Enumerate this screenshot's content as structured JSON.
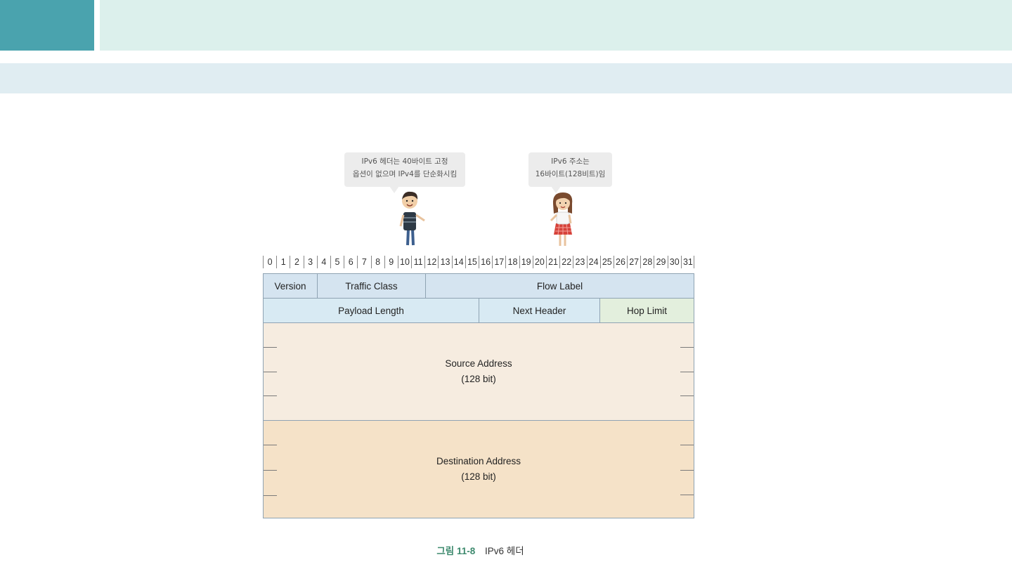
{
  "colors": {
    "header_square": "#4aa3ae",
    "header_bar": "#dcf0ec",
    "sub_bar": "#e0edf2",
    "row1_fill": "#d5e4f0",
    "row2_fill": "#d8eaf3",
    "hop_limit_fill": "#e3efdd",
    "source_fill": "#f6ece0",
    "destination_fill": "#f5e2c8",
    "caption_number": "#3e8a6e"
  },
  "bubbles": {
    "left": {
      "line1": "IPv6 헤더는 40바이트 고정",
      "line2": "옵션이 없으며 IPv4를 단순화시킴"
    },
    "right": {
      "line1": "IPv6 주소는",
      "line2": "16바이트(128비트)임"
    }
  },
  "characters": [
    "boy-character",
    "girl-character"
  ],
  "bit_labels": [
    "0",
    "1",
    "2",
    "3",
    "4",
    "5",
    "6",
    "7",
    "8",
    "9",
    "10",
    "11",
    "12",
    "13",
    "14",
    "15",
    "16",
    "17",
    "18",
    "19",
    "20",
    "21",
    "22",
    "23",
    "24",
    "25",
    "26",
    "27",
    "28",
    "29",
    "30",
    "31"
  ],
  "fields": {
    "version": "Version",
    "traffic_class": "Traffic Class",
    "flow_label": "Flow Label",
    "payload_length": "Payload Length",
    "next_header": "Next Header",
    "hop_limit": "Hop Limit",
    "source_address": {
      "name": "Source Address",
      "size": "(128 bit)"
    },
    "destination_address": {
      "name": "Destination Address",
      "size": "(128 bit)"
    }
  },
  "caption": {
    "number": "그림 11-8",
    "text": "IPv6 헤더"
  }
}
